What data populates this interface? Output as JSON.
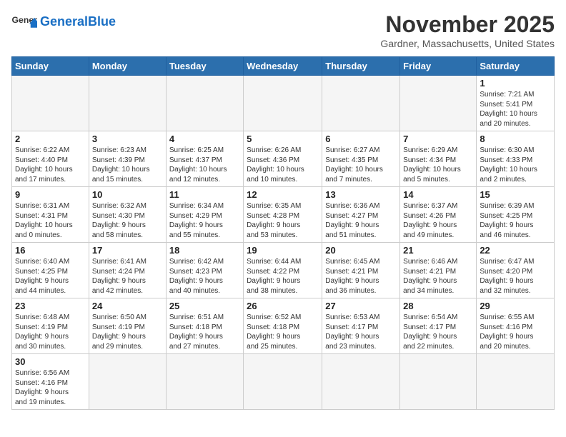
{
  "logo": {
    "text_general": "General",
    "text_blue": "Blue"
  },
  "title": "November 2025",
  "location": "Gardner, Massachusetts, United States",
  "days_of_week": [
    "Sunday",
    "Monday",
    "Tuesday",
    "Wednesday",
    "Thursday",
    "Friday",
    "Saturday"
  ],
  "weeks": [
    [
      {
        "day": "",
        "info": "",
        "empty": true
      },
      {
        "day": "",
        "info": "",
        "empty": true
      },
      {
        "day": "",
        "info": "",
        "empty": true
      },
      {
        "day": "",
        "info": "",
        "empty": true
      },
      {
        "day": "",
        "info": "",
        "empty": true
      },
      {
        "day": "",
        "info": "",
        "empty": true
      },
      {
        "day": "1",
        "info": "Sunrise: 7:21 AM\nSunset: 5:41 PM\nDaylight: 10 hours\nand 20 minutes.",
        "empty": false
      }
    ],
    [
      {
        "day": "2",
        "info": "Sunrise: 6:22 AM\nSunset: 4:40 PM\nDaylight: 10 hours\nand 17 minutes.",
        "empty": false
      },
      {
        "day": "3",
        "info": "Sunrise: 6:23 AM\nSunset: 4:39 PM\nDaylight: 10 hours\nand 15 minutes.",
        "empty": false
      },
      {
        "day": "4",
        "info": "Sunrise: 6:25 AM\nSunset: 4:37 PM\nDaylight: 10 hours\nand 12 minutes.",
        "empty": false
      },
      {
        "day": "5",
        "info": "Sunrise: 6:26 AM\nSunset: 4:36 PM\nDaylight: 10 hours\nand 10 minutes.",
        "empty": false
      },
      {
        "day": "6",
        "info": "Sunrise: 6:27 AM\nSunset: 4:35 PM\nDaylight: 10 hours\nand 7 minutes.",
        "empty": false
      },
      {
        "day": "7",
        "info": "Sunrise: 6:29 AM\nSunset: 4:34 PM\nDaylight: 10 hours\nand 5 minutes.",
        "empty": false
      },
      {
        "day": "8",
        "info": "Sunrise: 6:30 AM\nSunset: 4:33 PM\nDaylight: 10 hours\nand 2 minutes.",
        "empty": false
      }
    ],
    [
      {
        "day": "9",
        "info": "Sunrise: 6:31 AM\nSunset: 4:31 PM\nDaylight: 10 hours\nand 0 minutes.",
        "empty": false
      },
      {
        "day": "10",
        "info": "Sunrise: 6:32 AM\nSunset: 4:30 PM\nDaylight: 9 hours\nand 58 minutes.",
        "empty": false
      },
      {
        "day": "11",
        "info": "Sunrise: 6:34 AM\nSunset: 4:29 PM\nDaylight: 9 hours\nand 55 minutes.",
        "empty": false
      },
      {
        "day": "12",
        "info": "Sunrise: 6:35 AM\nSunset: 4:28 PM\nDaylight: 9 hours\nand 53 minutes.",
        "empty": false
      },
      {
        "day": "13",
        "info": "Sunrise: 6:36 AM\nSunset: 4:27 PM\nDaylight: 9 hours\nand 51 minutes.",
        "empty": false
      },
      {
        "day": "14",
        "info": "Sunrise: 6:37 AM\nSunset: 4:26 PM\nDaylight: 9 hours\nand 49 minutes.",
        "empty": false
      },
      {
        "day": "15",
        "info": "Sunrise: 6:39 AM\nSunset: 4:25 PM\nDaylight: 9 hours\nand 46 minutes.",
        "empty": false
      }
    ],
    [
      {
        "day": "16",
        "info": "Sunrise: 6:40 AM\nSunset: 4:25 PM\nDaylight: 9 hours\nand 44 minutes.",
        "empty": false
      },
      {
        "day": "17",
        "info": "Sunrise: 6:41 AM\nSunset: 4:24 PM\nDaylight: 9 hours\nand 42 minutes.",
        "empty": false
      },
      {
        "day": "18",
        "info": "Sunrise: 6:42 AM\nSunset: 4:23 PM\nDaylight: 9 hours\nand 40 minutes.",
        "empty": false
      },
      {
        "day": "19",
        "info": "Sunrise: 6:44 AM\nSunset: 4:22 PM\nDaylight: 9 hours\nand 38 minutes.",
        "empty": false
      },
      {
        "day": "20",
        "info": "Sunrise: 6:45 AM\nSunset: 4:21 PM\nDaylight: 9 hours\nand 36 minutes.",
        "empty": false
      },
      {
        "day": "21",
        "info": "Sunrise: 6:46 AM\nSunset: 4:21 PM\nDaylight: 9 hours\nand 34 minutes.",
        "empty": false
      },
      {
        "day": "22",
        "info": "Sunrise: 6:47 AM\nSunset: 4:20 PM\nDaylight: 9 hours\nand 32 minutes.",
        "empty": false
      }
    ],
    [
      {
        "day": "23",
        "info": "Sunrise: 6:48 AM\nSunset: 4:19 PM\nDaylight: 9 hours\nand 30 minutes.",
        "empty": false
      },
      {
        "day": "24",
        "info": "Sunrise: 6:50 AM\nSunset: 4:19 PM\nDaylight: 9 hours\nand 29 minutes.",
        "empty": false
      },
      {
        "day": "25",
        "info": "Sunrise: 6:51 AM\nSunset: 4:18 PM\nDaylight: 9 hours\nand 27 minutes.",
        "empty": false
      },
      {
        "day": "26",
        "info": "Sunrise: 6:52 AM\nSunset: 4:18 PM\nDaylight: 9 hours\nand 25 minutes.",
        "empty": false
      },
      {
        "day": "27",
        "info": "Sunrise: 6:53 AM\nSunset: 4:17 PM\nDaylight: 9 hours\nand 23 minutes.",
        "empty": false
      },
      {
        "day": "28",
        "info": "Sunrise: 6:54 AM\nSunset: 4:17 PM\nDaylight: 9 hours\nand 22 minutes.",
        "empty": false
      },
      {
        "day": "29",
        "info": "Sunrise: 6:55 AM\nSunset: 4:16 PM\nDaylight: 9 hours\nand 20 minutes.",
        "empty": false
      }
    ],
    [
      {
        "day": "30",
        "info": "Sunrise: 6:56 AM\nSunset: 4:16 PM\nDaylight: 9 hours\nand 19 minutes.",
        "empty": false
      },
      {
        "day": "",
        "info": "",
        "empty": true
      },
      {
        "day": "",
        "info": "",
        "empty": true
      },
      {
        "day": "",
        "info": "",
        "empty": true
      },
      {
        "day": "",
        "info": "",
        "empty": true
      },
      {
        "day": "",
        "info": "",
        "empty": true
      },
      {
        "day": "",
        "info": "",
        "empty": true
      }
    ]
  ]
}
